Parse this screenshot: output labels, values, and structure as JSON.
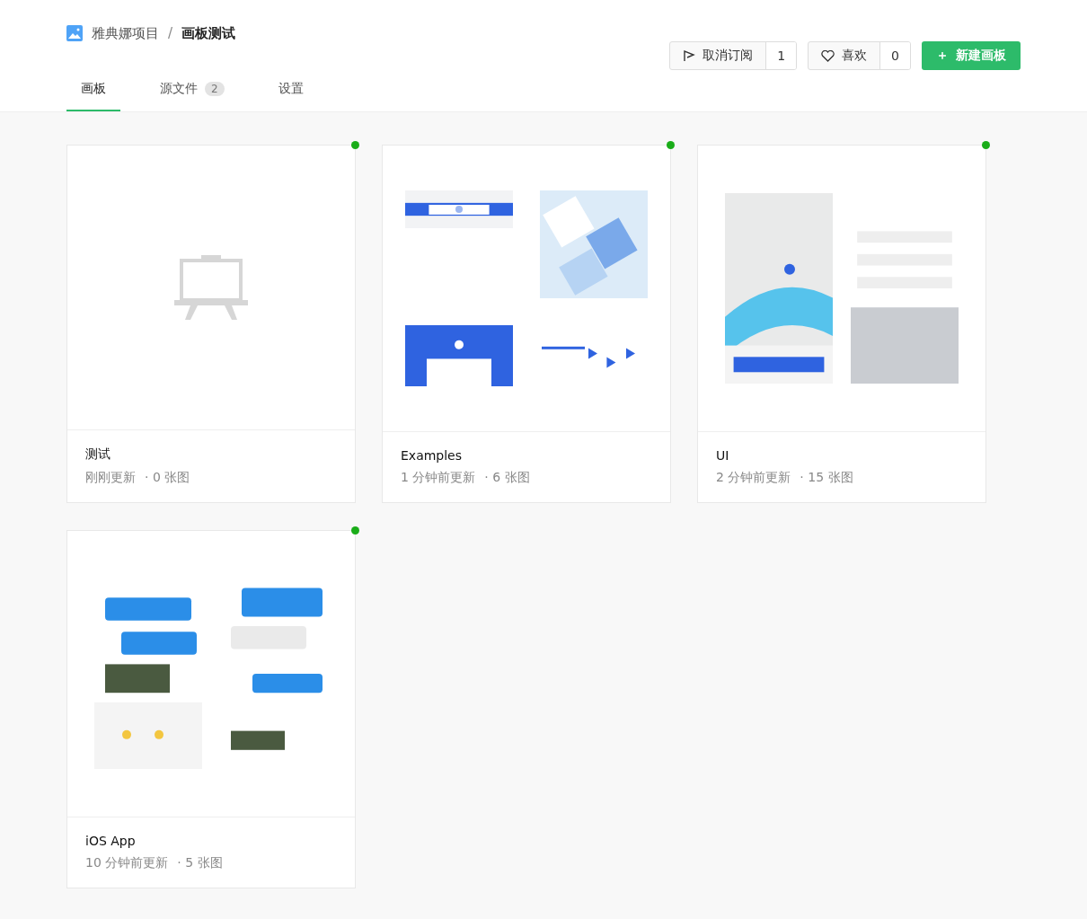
{
  "breadcrumb": {
    "project": "雅典娜项目",
    "separator": "/",
    "current": "画板测试"
  },
  "tabs": [
    {
      "label": "画板",
      "selected": true
    },
    {
      "label": "源文件",
      "badge": "2",
      "selected": false
    },
    {
      "label": "设置",
      "selected": false
    }
  ],
  "actions": {
    "unsubscribe": {
      "label": "取消订阅",
      "count": "1"
    },
    "like": {
      "label": "喜欢",
      "count": "0"
    },
    "create": {
      "icon": "＋",
      "label": "新建画板"
    }
  },
  "cards": [
    {
      "kind": "empty",
      "title": "测试",
      "updated": "刚刚更新",
      "count": "· 0 张图",
      "color": "#1aad19"
    },
    {
      "kind": "grid",
      "title": "Examples",
      "updated": "1 分钟前更新",
      "count": "· 6 张图",
      "color": "#1aad19"
    },
    {
      "kind": "pair",
      "title": "UI",
      "updated": "2 分钟前更新",
      "count": "· 15 张图",
      "color": "#1aad19"
    },
    {
      "kind": "pair",
      "title": "iOS App",
      "updated": "10 分钟前更新",
      "count": "· 5 张图",
      "color": "#1aad19"
    }
  ]
}
